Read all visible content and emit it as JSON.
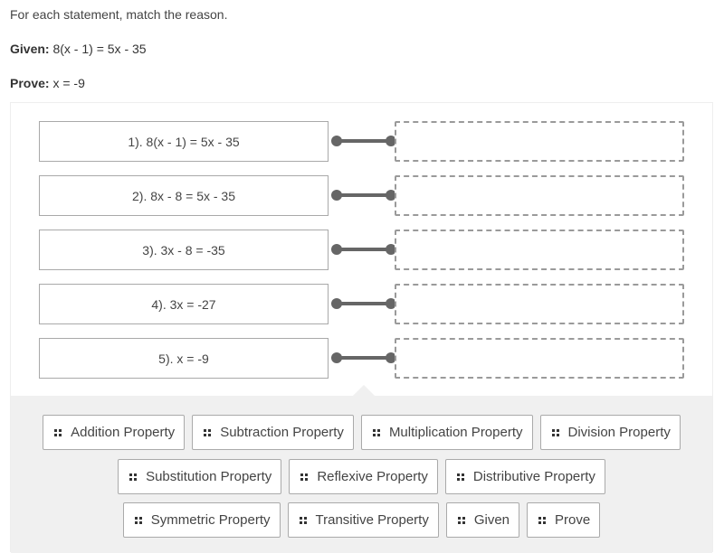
{
  "instruction": "For each statement, match the reason.",
  "given": {
    "label": "Given:",
    "value": "8(x - 1) = 5x - 35"
  },
  "prove": {
    "label": "Prove:",
    "value": "x = -9"
  },
  "statements": [
    {
      "text": "1). 8(x - 1) = 5x - 35",
      "reason": ""
    },
    {
      "text": "2). 8x - 8 = 5x - 35",
      "reason": ""
    },
    {
      "text": "3). 3x - 8 = -35",
      "reason": ""
    },
    {
      "text": "4). 3x = -27",
      "reason": ""
    },
    {
      "text": "5). x = -9",
      "reason": ""
    }
  ],
  "options": {
    "row1": [
      "Addition Property",
      "Subtraction Property",
      "Multiplication Property",
      "Division Property"
    ],
    "row2": [
      "Substitution Property",
      "Reflexive Property",
      "Distributive Property"
    ],
    "row3": [
      "Symmetric Property",
      "Transitive Property",
      "Given",
      "Prove"
    ]
  },
  "icons": {
    "drag_handle": "grip-dots-icon"
  },
  "colors": {
    "tray_bg": "#f0f0f0",
    "connector": "#666666",
    "border": "#a9a9a9"
  }
}
